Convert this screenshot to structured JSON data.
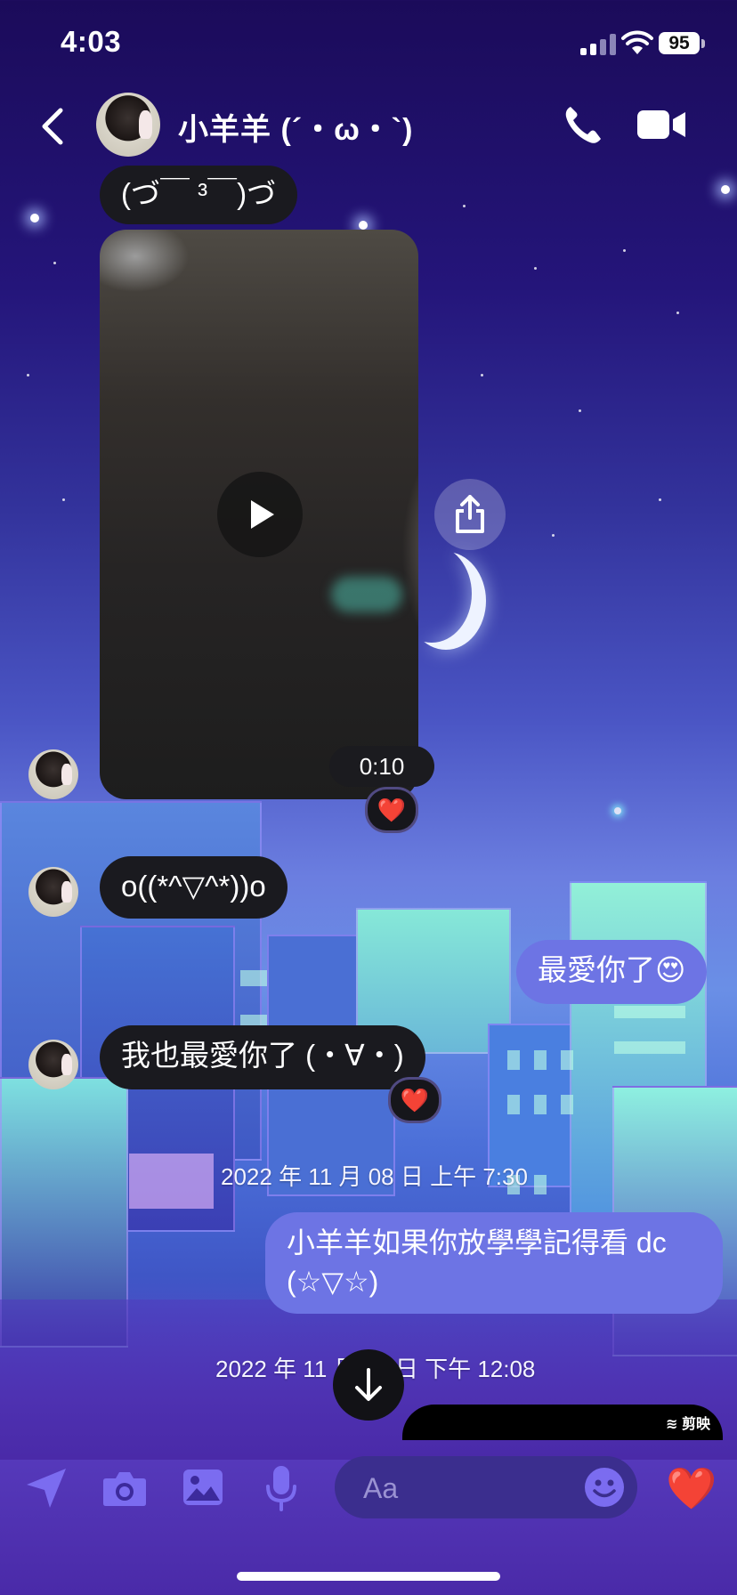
{
  "status_bar": {
    "time": "4:03",
    "battery": "95"
  },
  "header": {
    "contact_name": "小羊羊 (´・ω・`)"
  },
  "messages": {
    "top_partial": "(づ￣ ³￣)づ",
    "video_duration": "0:10",
    "msg1": "o((*^▽^*))o",
    "msg2_sent": "最愛你了😍",
    "msg3": "我也最愛你了 (・∀・)",
    "reaction": "❤️",
    "timestamp1": "2022 年 11 月 08 日 上午 7:30",
    "msg4_sent_line1": "小羊羊如果你放學學記得看 dc",
    "msg4_sent_line2": "(☆▽☆)",
    "timestamp2": "2022 年 11 月 09 日 下午 12:08",
    "partial_label": "剪映"
  },
  "composer": {
    "placeholder": "Aa",
    "like": "❤️"
  },
  "colors": {
    "sent_bubble": "#6d74e4",
    "received_bubble": "#1a1a1f",
    "accent": "#7b6cf0"
  }
}
